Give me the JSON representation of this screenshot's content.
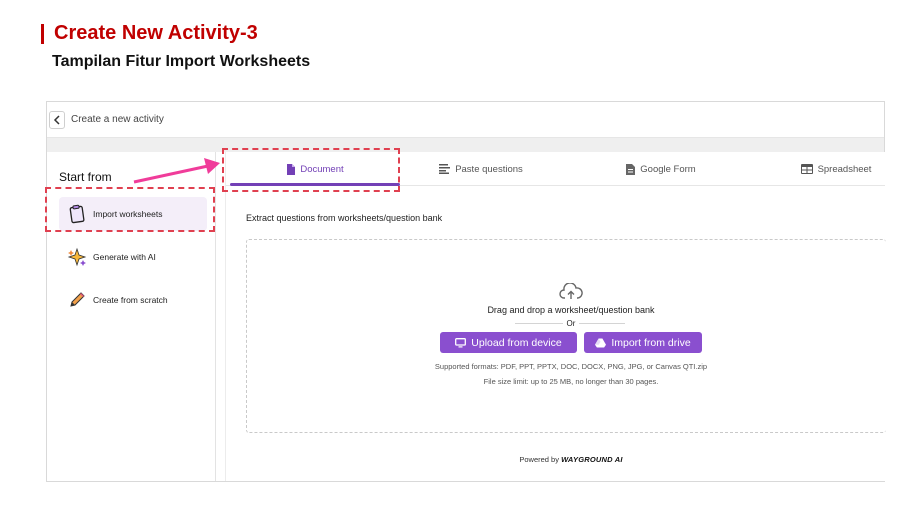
{
  "slide": {
    "title": "Create New Activity-3",
    "subtitle": "Tampilan Fitur Import Worksheets",
    "accent_color": "#c00000"
  },
  "header": {
    "back_icon": "chevron-left-icon",
    "title": "Create a new activity"
  },
  "sidebar": {
    "title": "Start from",
    "items": [
      {
        "label": "Import worksheets",
        "icon": "clipboard-icon",
        "active": true
      },
      {
        "label": "Generate with AI",
        "icon": "sparkles-icon",
        "active": false
      },
      {
        "label": "Create from scratch",
        "icon": "pencil-icon",
        "active": false
      }
    ]
  },
  "tabs": [
    {
      "label": "Document",
      "icon": "document-icon",
      "active": true
    },
    {
      "label": "Paste questions",
      "icon": "text-lines-icon",
      "active": false
    },
    {
      "label": "Google Form",
      "icon": "form-icon",
      "active": false
    },
    {
      "label": "Spreadsheet",
      "icon": "table-icon",
      "active": false
    }
  ],
  "main": {
    "extract_text": "Extract questions from worksheets/question bank",
    "drag_text": "Drag and drop a worksheet/question bank",
    "or_text": "Or",
    "upload_button": "Upload from device",
    "drive_button": "Import from drive",
    "supported_formats": "Supported formats: PDF, PPT, PPTX, DOC, DOCX, PNG, JPG, or Canvas QTI.zip",
    "size_limit": "File size limit: up to 25 MB, no longer than 30 pages.",
    "powered_by": "Powered by",
    "brand": "WAYGROUND AI"
  },
  "colors": {
    "primary": "#8a4fcf",
    "active_tab": "#7340b6",
    "annotation": "#e04050",
    "arrow": "#f03c9a"
  }
}
